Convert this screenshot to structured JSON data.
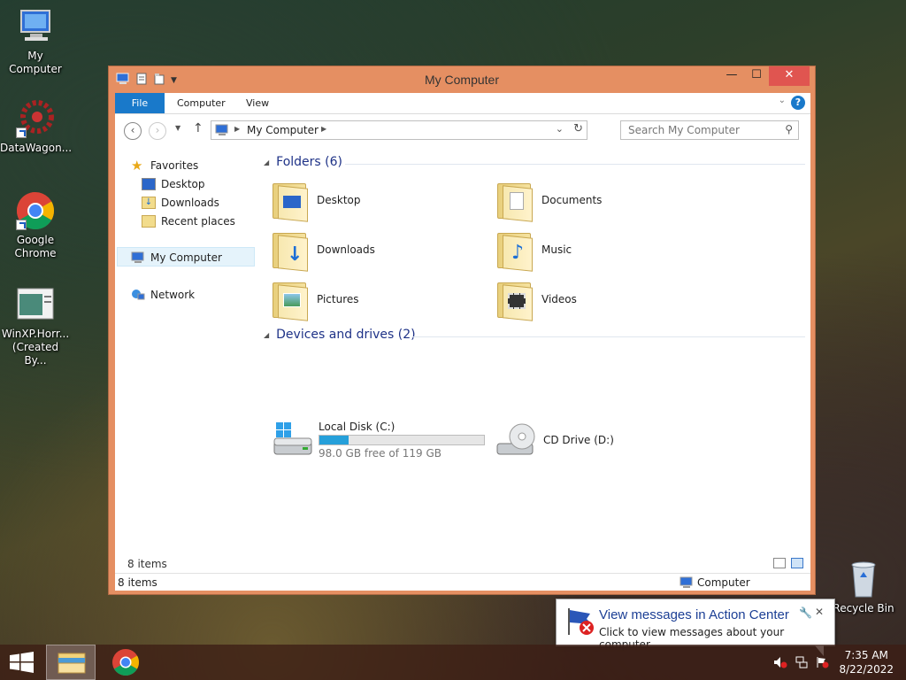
{
  "desktop": {
    "icons": [
      {
        "label": "My Computer",
        "icon": "my-computer-icon"
      },
      {
        "label": "DataWagon...",
        "icon": "datawagon-icon"
      },
      {
        "label": "Google Chrome",
        "icon": "chrome-icon"
      },
      {
        "label": "WinXP.Horr... (Created By...",
        "icon": "document-icon"
      }
    ],
    "recycle_bin": "Recycle Bin"
  },
  "window": {
    "title": "My Computer",
    "controls": {
      "minimize": "—",
      "maximize": "☐",
      "close": "✕"
    },
    "ribbon_tabs": [
      "File",
      "Computer",
      "View"
    ],
    "help": "?",
    "address": {
      "location": "My Computer"
    },
    "search": {
      "placeholder": "Search My Computer"
    },
    "nav": {
      "favorites": "Favorites",
      "items": [
        "Desktop",
        "Downloads",
        "Recent places"
      ],
      "computer": "My Computer",
      "network": "Network"
    },
    "folders": {
      "header": "Folders (6)",
      "items": [
        "Desktop",
        "Documents",
        "Downloads",
        "Music",
        "Pictures",
        "Videos"
      ]
    },
    "devices": {
      "header": "Devices and drives (2)",
      "local_disk": {
        "name": "Local Disk (C:)",
        "free_text": "98.0 GB free of 119 GB",
        "used_fraction": 0.176
      },
      "cd_drive": {
        "name": "CD Drive (D:)"
      }
    },
    "status": {
      "items_inner": "8 items",
      "items": "8 items",
      "location": "Computer"
    }
  },
  "notification": {
    "title": "View messages in Action Center",
    "body": "Click to view messages about your computer.",
    "close": "✕"
  },
  "taskbar": {
    "time": "7:35 AM",
    "date": "8/22/2022"
  },
  "colors": {
    "accent": "#1979ca",
    "window_frame": "#e58f62",
    "close": "#e05550"
  }
}
